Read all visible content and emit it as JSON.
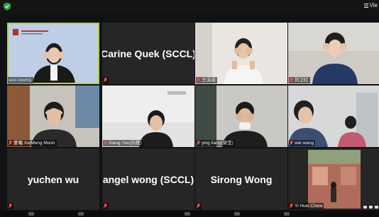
{
  "window": {
    "view_label": "Vie",
    "top_right_icon": "view-bars-icon",
    "shield_icon": "shield-icon"
  },
  "accent_color": "#b8d33a",
  "muted_icon": "mic-muted-icon",
  "participants": [
    {
      "name": "scci zoom1",
      "has_video": true,
      "active_speaker": true,
      "muted": false
    },
    {
      "name": "Carine Quek (SCCL)",
      "has_video": false,
      "muted": true
    },
    {
      "name": "王涓涓",
      "has_video": true,
      "muted": true
    },
    {
      "name": "刘卫红",
      "has_video": true,
      "muted": true
    },
    {
      "name": "蒙曦 XieMeng Moon",
      "has_video": true,
      "muted": true
    },
    {
      "name": "Xiang Yan(向艳)",
      "has_video": true,
      "muted": true
    },
    {
      "name": "ying liang(梁莹)",
      "has_video": true,
      "muted": true
    },
    {
      "name": "wei wang",
      "has_video": true,
      "muted": true
    },
    {
      "name": "yuchen wu",
      "has_video": false,
      "muted": true
    },
    {
      "name": "angel wong (SCCL)",
      "has_video": false,
      "muted": true
    },
    {
      "name": "Sirong Wong",
      "has_video": false,
      "muted": true
    },
    {
      "name": "Yi Huei Chew",
      "has_video": true,
      "muted": true
    }
  ]
}
